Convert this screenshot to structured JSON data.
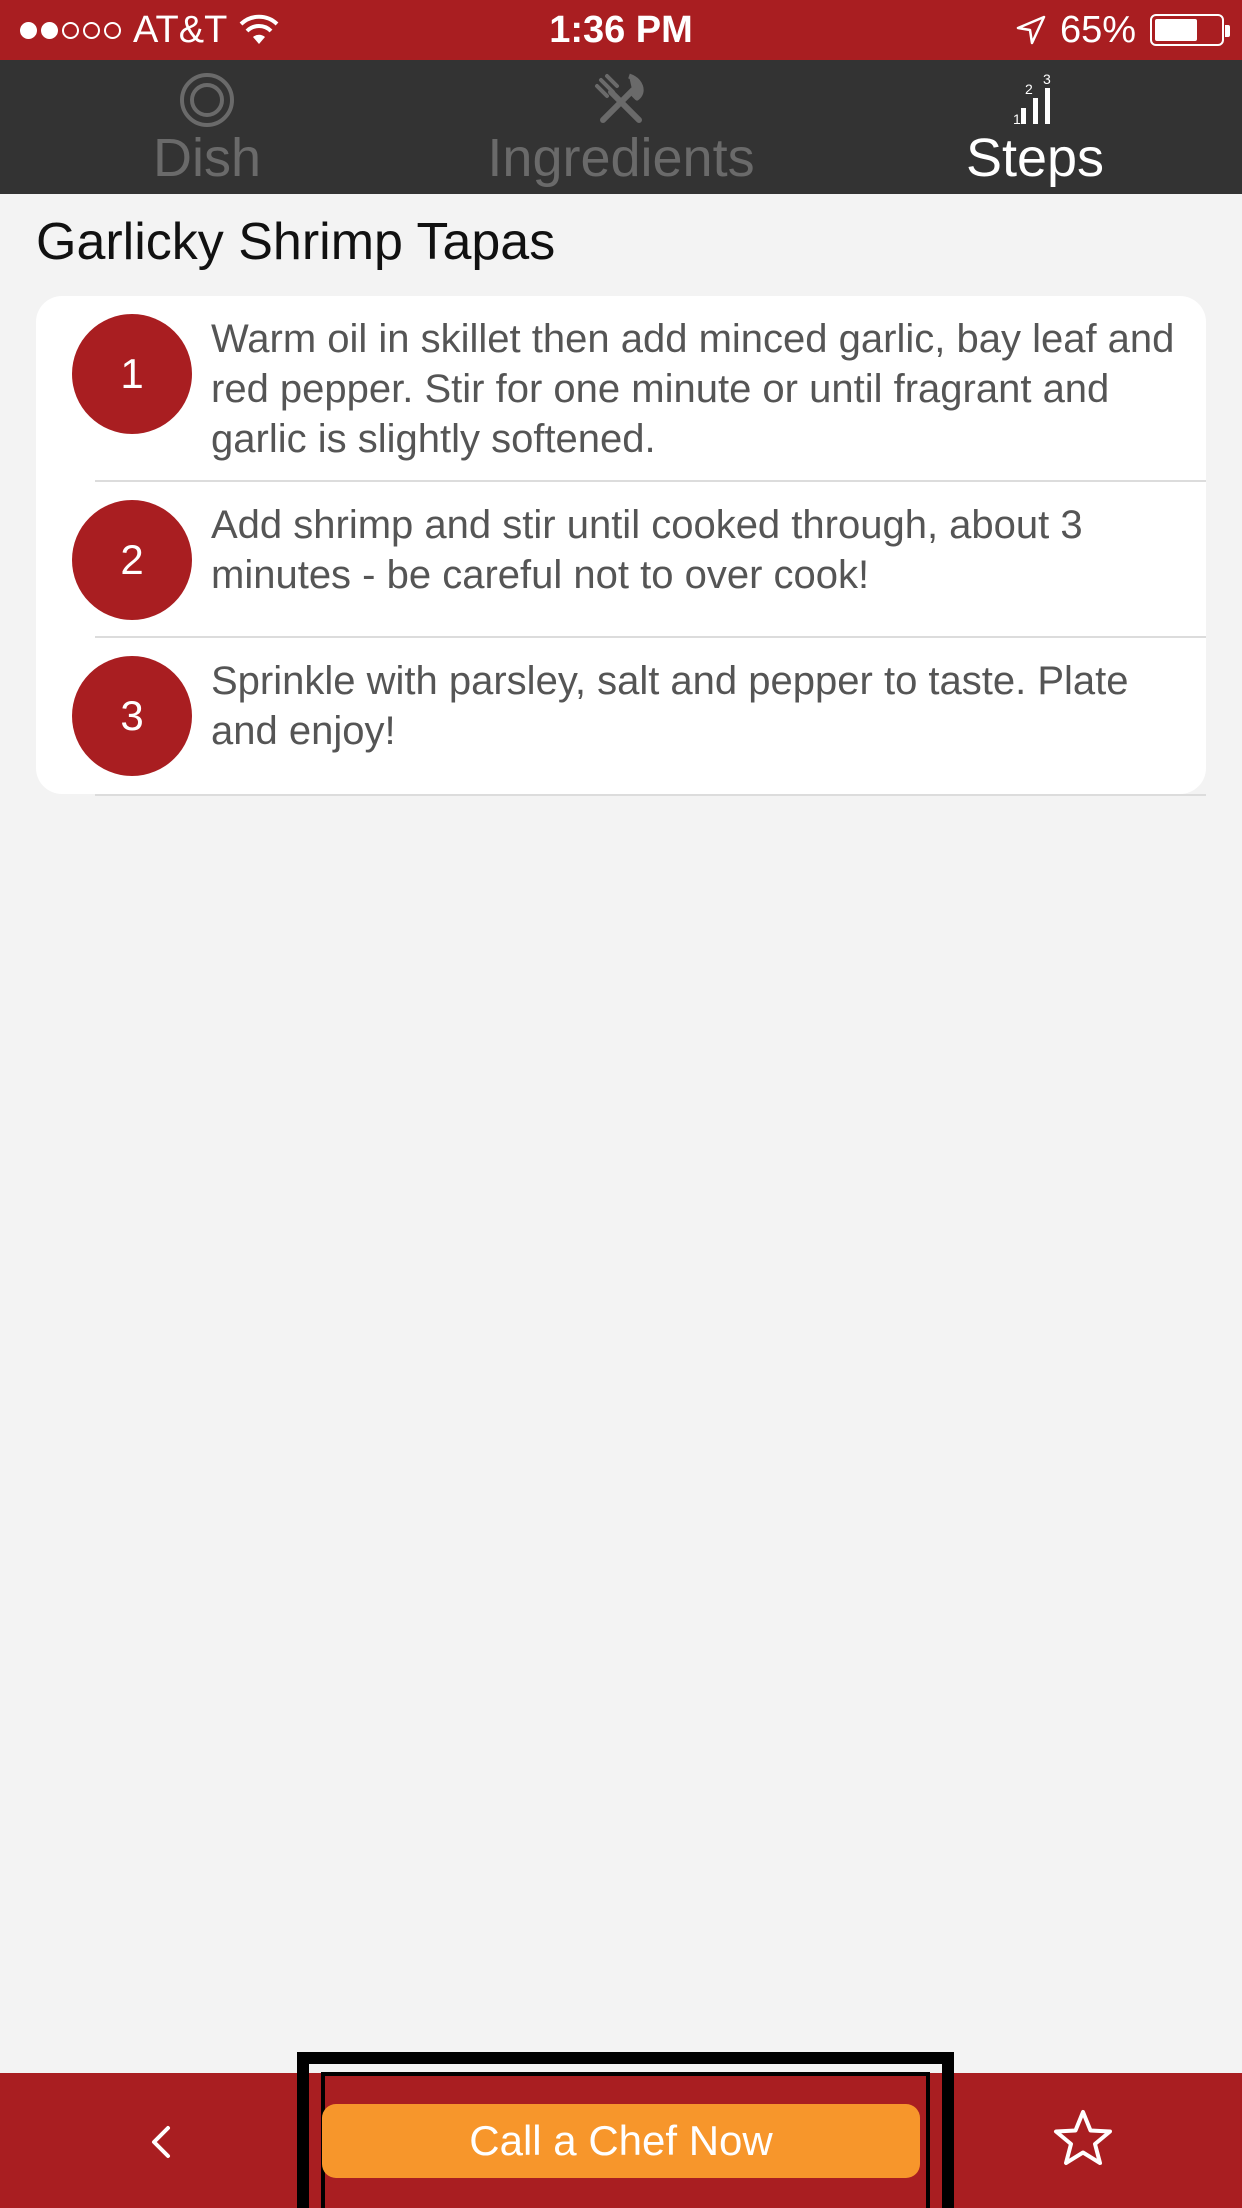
{
  "status_bar": {
    "carrier": "AT&T",
    "time": "1:36 PM",
    "battery": "65%",
    "signal_bars_filled": 2,
    "signal_bars_total": 5,
    "battery_level": 0.65
  },
  "tabs": [
    {
      "label": "Dish",
      "icon": "plate-icon",
      "active": false
    },
    {
      "label": "Ingredients",
      "icon": "utensils-icon",
      "active": false
    },
    {
      "label": "Steps",
      "icon": "steps-icon",
      "active": true
    }
  ],
  "steps_icon_digits": [
    "1",
    "2",
    "3"
  ],
  "dish": {
    "title": "Garlicky Shrimp Tapas"
  },
  "steps": [
    {
      "number": "1",
      "text": "Warm oil in skillet then add minced garlic, bay leaf and red pepper. Stir for one minute or until fragrant and garlic is slightly softened."
    },
    {
      "number": "2",
      "text": "Add shrimp and stir until cooked through, about 3 minutes - be careful not to over cook!"
    },
    {
      "number": "3",
      "text": "Sprinkle with parsley, salt and pepper to taste. Plate and enjoy!"
    }
  ],
  "bottom_bar": {
    "cta_label": "Call a Chef Now",
    "back_icon": "chevron-left-icon",
    "favorite_icon": "star-icon"
  },
  "colors": {
    "brand_red": "#a91e21",
    "tab_bg": "#333333",
    "cta_orange": "#f7962b",
    "background": "#f3f3f3"
  }
}
